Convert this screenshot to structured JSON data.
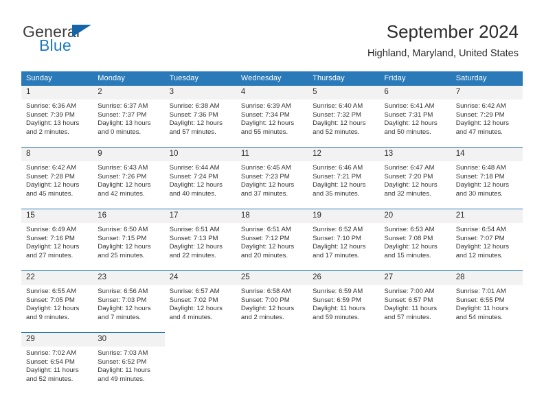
{
  "brand": {
    "word_one": "General",
    "word_two": "Blue",
    "triangle_icon": "brand-triangle-icon"
  },
  "header": {
    "month_title": "September 2024",
    "location": "Highland, Maryland, United States"
  },
  "colors": {
    "header_blue": "#2a7ab9",
    "daynum_band": "#f2f2f2",
    "brand_blue": "#1b79c4",
    "text": "#333333"
  },
  "weekdays": [
    "Sunday",
    "Monday",
    "Tuesday",
    "Wednesday",
    "Thursday",
    "Friday",
    "Saturday"
  ],
  "labels": {
    "sunrise_prefix": "Sunrise:",
    "sunset_prefix": "Sunset:",
    "daylight_prefix": "Daylight:"
  },
  "weeks": [
    [
      {
        "day": "1",
        "sunrise": "Sunrise: 6:36 AM",
        "sunset": "Sunset: 7:39 PM",
        "daylight_line1": "Daylight: 13 hours",
        "daylight_line2": "and 2 minutes."
      },
      {
        "day": "2",
        "sunrise": "Sunrise: 6:37 AM",
        "sunset": "Sunset: 7:37 PM",
        "daylight_line1": "Daylight: 13 hours",
        "daylight_line2": "and 0 minutes."
      },
      {
        "day": "3",
        "sunrise": "Sunrise: 6:38 AM",
        "sunset": "Sunset: 7:36 PM",
        "daylight_line1": "Daylight: 12 hours",
        "daylight_line2": "and 57 minutes."
      },
      {
        "day": "4",
        "sunrise": "Sunrise: 6:39 AM",
        "sunset": "Sunset: 7:34 PM",
        "daylight_line1": "Daylight: 12 hours",
        "daylight_line2": "and 55 minutes."
      },
      {
        "day": "5",
        "sunrise": "Sunrise: 6:40 AM",
        "sunset": "Sunset: 7:32 PM",
        "daylight_line1": "Daylight: 12 hours",
        "daylight_line2": "and 52 minutes."
      },
      {
        "day": "6",
        "sunrise": "Sunrise: 6:41 AM",
        "sunset": "Sunset: 7:31 PM",
        "daylight_line1": "Daylight: 12 hours",
        "daylight_line2": "and 50 minutes."
      },
      {
        "day": "7",
        "sunrise": "Sunrise: 6:42 AM",
        "sunset": "Sunset: 7:29 PM",
        "daylight_line1": "Daylight: 12 hours",
        "daylight_line2": "and 47 minutes."
      }
    ],
    [
      {
        "day": "8",
        "sunrise": "Sunrise: 6:42 AM",
        "sunset": "Sunset: 7:28 PM",
        "daylight_line1": "Daylight: 12 hours",
        "daylight_line2": "and 45 minutes."
      },
      {
        "day": "9",
        "sunrise": "Sunrise: 6:43 AM",
        "sunset": "Sunset: 7:26 PM",
        "daylight_line1": "Daylight: 12 hours",
        "daylight_line2": "and 42 minutes."
      },
      {
        "day": "10",
        "sunrise": "Sunrise: 6:44 AM",
        "sunset": "Sunset: 7:24 PM",
        "daylight_line1": "Daylight: 12 hours",
        "daylight_line2": "and 40 minutes."
      },
      {
        "day": "11",
        "sunrise": "Sunrise: 6:45 AM",
        "sunset": "Sunset: 7:23 PM",
        "daylight_line1": "Daylight: 12 hours",
        "daylight_line2": "and 37 minutes."
      },
      {
        "day": "12",
        "sunrise": "Sunrise: 6:46 AM",
        "sunset": "Sunset: 7:21 PM",
        "daylight_line1": "Daylight: 12 hours",
        "daylight_line2": "and 35 minutes."
      },
      {
        "day": "13",
        "sunrise": "Sunrise: 6:47 AM",
        "sunset": "Sunset: 7:20 PM",
        "daylight_line1": "Daylight: 12 hours",
        "daylight_line2": "and 32 minutes."
      },
      {
        "day": "14",
        "sunrise": "Sunrise: 6:48 AM",
        "sunset": "Sunset: 7:18 PM",
        "daylight_line1": "Daylight: 12 hours",
        "daylight_line2": "and 30 minutes."
      }
    ],
    [
      {
        "day": "15",
        "sunrise": "Sunrise: 6:49 AM",
        "sunset": "Sunset: 7:16 PM",
        "daylight_line1": "Daylight: 12 hours",
        "daylight_line2": "and 27 minutes."
      },
      {
        "day": "16",
        "sunrise": "Sunrise: 6:50 AM",
        "sunset": "Sunset: 7:15 PM",
        "daylight_line1": "Daylight: 12 hours",
        "daylight_line2": "and 25 minutes."
      },
      {
        "day": "17",
        "sunrise": "Sunrise: 6:51 AM",
        "sunset": "Sunset: 7:13 PM",
        "daylight_line1": "Daylight: 12 hours",
        "daylight_line2": "and 22 minutes."
      },
      {
        "day": "18",
        "sunrise": "Sunrise: 6:51 AM",
        "sunset": "Sunset: 7:12 PM",
        "daylight_line1": "Daylight: 12 hours",
        "daylight_line2": "and 20 minutes."
      },
      {
        "day": "19",
        "sunrise": "Sunrise: 6:52 AM",
        "sunset": "Sunset: 7:10 PM",
        "daylight_line1": "Daylight: 12 hours",
        "daylight_line2": "and 17 minutes."
      },
      {
        "day": "20",
        "sunrise": "Sunrise: 6:53 AM",
        "sunset": "Sunset: 7:08 PM",
        "daylight_line1": "Daylight: 12 hours",
        "daylight_line2": "and 15 minutes."
      },
      {
        "day": "21",
        "sunrise": "Sunrise: 6:54 AM",
        "sunset": "Sunset: 7:07 PM",
        "daylight_line1": "Daylight: 12 hours",
        "daylight_line2": "and 12 minutes."
      }
    ],
    [
      {
        "day": "22",
        "sunrise": "Sunrise: 6:55 AM",
        "sunset": "Sunset: 7:05 PM",
        "daylight_line1": "Daylight: 12 hours",
        "daylight_line2": "and 9 minutes."
      },
      {
        "day": "23",
        "sunrise": "Sunrise: 6:56 AM",
        "sunset": "Sunset: 7:03 PM",
        "daylight_line1": "Daylight: 12 hours",
        "daylight_line2": "and 7 minutes."
      },
      {
        "day": "24",
        "sunrise": "Sunrise: 6:57 AM",
        "sunset": "Sunset: 7:02 PM",
        "daylight_line1": "Daylight: 12 hours",
        "daylight_line2": "and 4 minutes."
      },
      {
        "day": "25",
        "sunrise": "Sunrise: 6:58 AM",
        "sunset": "Sunset: 7:00 PM",
        "daylight_line1": "Daylight: 12 hours",
        "daylight_line2": "and 2 minutes."
      },
      {
        "day": "26",
        "sunrise": "Sunrise: 6:59 AM",
        "sunset": "Sunset: 6:59 PM",
        "daylight_line1": "Daylight: 11 hours",
        "daylight_line2": "and 59 minutes."
      },
      {
        "day": "27",
        "sunrise": "Sunrise: 7:00 AM",
        "sunset": "Sunset: 6:57 PM",
        "daylight_line1": "Daylight: 11 hours",
        "daylight_line2": "and 57 minutes."
      },
      {
        "day": "28",
        "sunrise": "Sunrise: 7:01 AM",
        "sunset": "Sunset: 6:55 PM",
        "daylight_line1": "Daylight: 11 hours",
        "daylight_line2": "and 54 minutes."
      }
    ],
    [
      {
        "day": "29",
        "sunrise": "Sunrise: 7:02 AM",
        "sunset": "Sunset: 6:54 PM",
        "daylight_line1": "Daylight: 11 hours",
        "daylight_line2": "and 52 minutes."
      },
      {
        "day": "30",
        "sunrise": "Sunrise: 7:03 AM",
        "sunset": "Sunset: 6:52 PM",
        "daylight_line1": "Daylight: 11 hours",
        "daylight_line2": "and 49 minutes."
      },
      {
        "day": "",
        "sunrise": "",
        "sunset": "",
        "daylight_line1": "",
        "daylight_line2": ""
      },
      {
        "day": "",
        "sunrise": "",
        "sunset": "",
        "daylight_line1": "",
        "daylight_line2": ""
      },
      {
        "day": "",
        "sunrise": "",
        "sunset": "",
        "daylight_line1": "",
        "daylight_line2": ""
      },
      {
        "day": "",
        "sunrise": "",
        "sunset": "",
        "daylight_line1": "",
        "daylight_line2": ""
      },
      {
        "day": "",
        "sunrise": "",
        "sunset": "",
        "daylight_line1": "",
        "daylight_line2": ""
      }
    ]
  ]
}
